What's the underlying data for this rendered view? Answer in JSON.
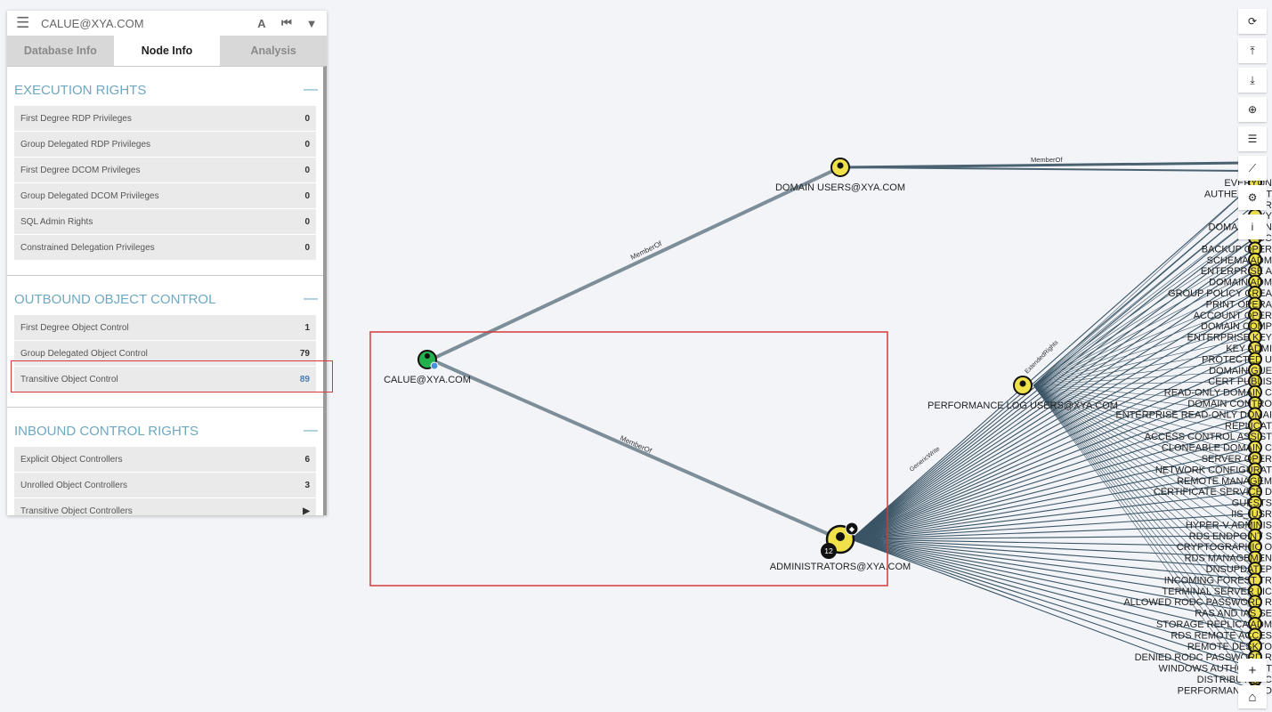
{
  "search": {
    "value": "CALUE@XYA.COM"
  },
  "tabs": [
    {
      "label": "Database Info",
      "active": false
    },
    {
      "label": "Node Info",
      "active": true
    },
    {
      "label": "Analysis",
      "active": false
    }
  ],
  "sections": {
    "execution": {
      "title": "EXECUTION RIGHTS",
      "rows": [
        {
          "label": "First Degree RDP Privileges",
          "value": "0"
        },
        {
          "label": "Group Delegated RDP Privileges",
          "value": "0"
        },
        {
          "label": "First Degree DCOM Privileges",
          "value": "0"
        },
        {
          "label": "Group Delegated DCOM Privileges",
          "value": "0"
        },
        {
          "label": "SQL Admin Rights",
          "value": "0"
        },
        {
          "label": "Constrained Delegation Privileges",
          "value": "0"
        }
      ]
    },
    "outbound": {
      "title": "OUTBOUND OBJECT CONTROL",
      "rows": [
        {
          "label": "First Degree Object Control",
          "value": "1"
        },
        {
          "label": "Group Delegated Object Control",
          "value": "79"
        },
        {
          "label": "Transitive Object Control",
          "value": "89"
        }
      ]
    },
    "inbound": {
      "title": "INBOUND CONTROL RIGHTS",
      "rows": [
        {
          "label": "Explicit Object Controllers",
          "value": "6"
        },
        {
          "label": "Unrolled Object Controllers",
          "value": "3"
        },
        {
          "label": "Transitive Object Controllers",
          "value": "▶"
        }
      ]
    }
  },
  "graph": {
    "nodes": {
      "user": "CALUE@XYA.COM",
      "domain_users": "DOMAIN USERS@XYA.COM",
      "admins": "ADMINISTRATORS@XYA.COM",
      "perf_log": "PERFORMANCE LOG USERS@XYA.COM",
      "admins_badge": "12"
    },
    "edges": {
      "member_of": "MemberOf",
      "generic_write": "GenericWrite",
      "extended_rights": "ExtendedRights"
    },
    "right_labels": [
      "EVERYON",
      "AUTHENTICAT",
      "USER",
      "XY",
      "DOMAIN CON",
      "DC",
      "BACKUP OPER",
      "SCHEMA ADM",
      "ENTERPRISE A",
      "DOMAIN ADM",
      "GROUP POLICY CREA",
      "PRINT OPERA",
      "ACCOUNT OPER",
      "DOMAIN COMP",
      "ENTERPRISE KEY",
      "KEY ADMI",
      "PROTECTED U",
      "DOMAIN GUE",
      "CERT PUBLIS",
      "READ-ONLY DOMAIN C",
      "DOMAIN CONTRO",
      "ENTERPRISE READ-ONLY DOMAI",
      "REPLICAT",
      "ACCESS CONTROL ASSIST",
      "CLONEABLE DOMAIN C",
      "SERVER OPER",
      "NETWORK CONFIGURAT",
      "REMOTE MANAGEM",
      "CERTIFICATE SERVICE D",
      "GUESTS",
      "IIS_IUSR",
      "HYPER-V ADMINIS",
      "RDS ENDPOINT S",
      "CRYPTOGRAPHIC O",
      "RDS MANAGEMEN",
      "DNSUPDATEP",
      "INCOMING FOREST TR",
      "TERMINAL SERVER LIC",
      "ALLOWED RODC PASSWORD R",
      "RAS AND IAS SE",
      "STORAGE REPLICA ADM",
      "RDS REMOTE ACCES",
      "REMOTE DESKTO",
      "DENIED RODC PASSWORD R",
      "WINDOWS AUTHORIZAT",
      "DISTRIBUTED C",
      "PERFORMANCE MO"
    ]
  },
  "toolbar": [
    {
      "name": "refresh-icon",
      "glyph": "⟳"
    },
    {
      "name": "upload-icon",
      "glyph": "⤒"
    },
    {
      "name": "download-icon",
      "glyph": "⤓"
    },
    {
      "name": "import-icon",
      "glyph": "⊕"
    },
    {
      "name": "queries-icon",
      "glyph": "☰"
    },
    {
      "name": "chart-icon",
      "glyph": "⟋"
    },
    {
      "name": "settings-icon",
      "glyph": "⚙"
    },
    {
      "name": "info-icon",
      "glyph": "i"
    }
  ],
  "zoom": {
    "in": "+",
    "home": "⌂"
  },
  "colors": {
    "accent": "#6fa8c0",
    "edge": "#3b5566",
    "node": "#f0e04a",
    "highlight": "#d43a3a"
  }
}
